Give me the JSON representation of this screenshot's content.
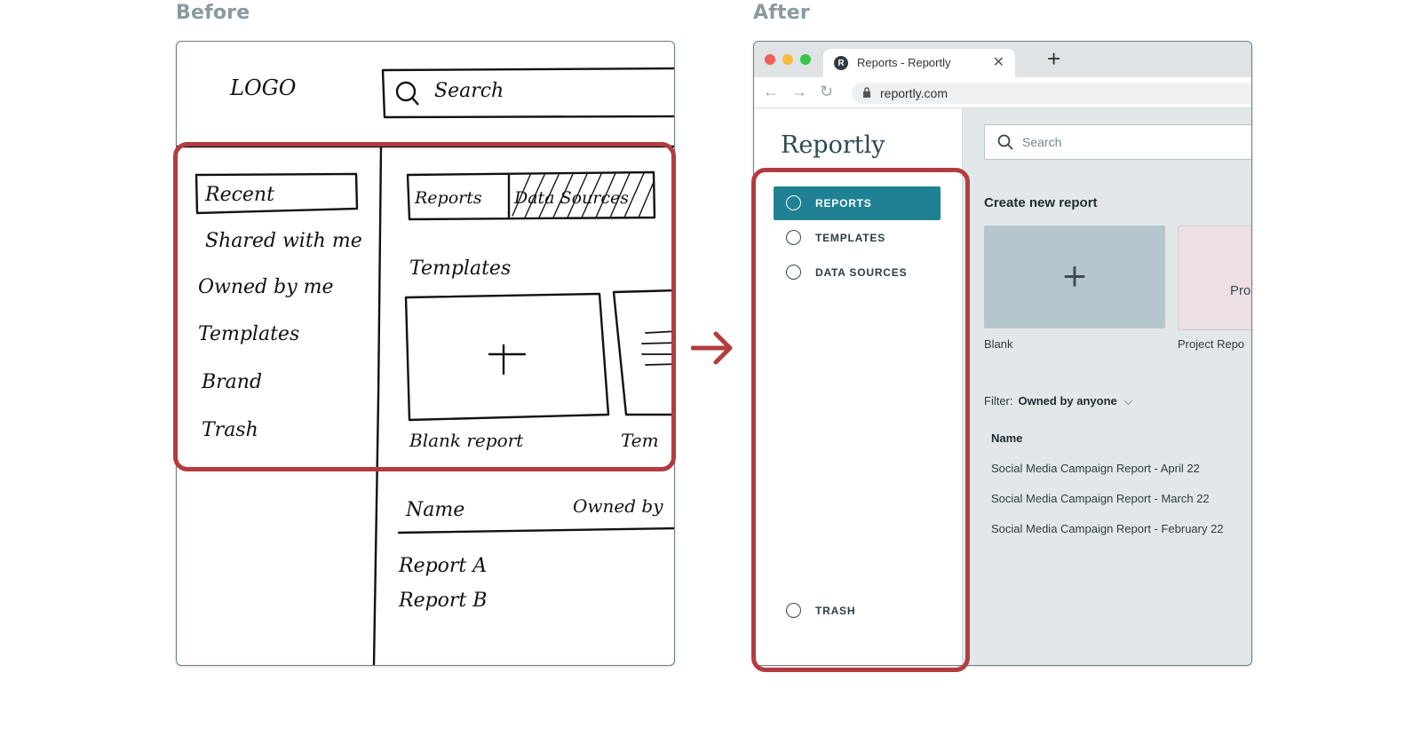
{
  "before": {
    "heading": "Before",
    "logo": "LOGO",
    "search": "Search",
    "sidebar": [
      "Recent",
      "Shared with me",
      "Owned by me",
      "Templates",
      "Brand",
      "Trash"
    ],
    "tabs": [
      "Reports",
      "Data Sources"
    ],
    "templates_heading": "Templates",
    "blank_report": "Blank report",
    "truncated_template": "Tem",
    "table_headers": [
      "Name",
      "Owned by"
    ],
    "rows": [
      "Report A",
      "Report B"
    ]
  },
  "after": {
    "heading": "After",
    "tab": {
      "favicon": "R",
      "title": "Reports - Reportly"
    },
    "url": "reportly.com",
    "brand": "Reportly",
    "nav": [
      {
        "label": "REPORTS",
        "active": true
      },
      {
        "label": "TEMPLATES",
        "active": false
      },
      {
        "label": "DATA SOURCES",
        "active": false
      }
    ],
    "trash": "TRASH",
    "search_placeholder": "Search",
    "section_title": "Create new report",
    "cards": [
      {
        "label": "Blank",
        "thumb": "+"
      },
      {
        "label": "Project Repo",
        "thumb": "Pro"
      }
    ],
    "filter": {
      "label": "Filter:",
      "value": "Owned by anyone",
      "caret": "⌵"
    },
    "table": {
      "header": "Name",
      "rows": [
        "Social Media Campaign Report - April 22",
        "Social Media Campaign Report - March 22",
        "Social Media Campaign Report - February 22"
      ]
    }
  },
  "colors": {
    "accent": "#1f8193",
    "highlight": "#b23c40",
    "heading": "#8a9aa1"
  }
}
